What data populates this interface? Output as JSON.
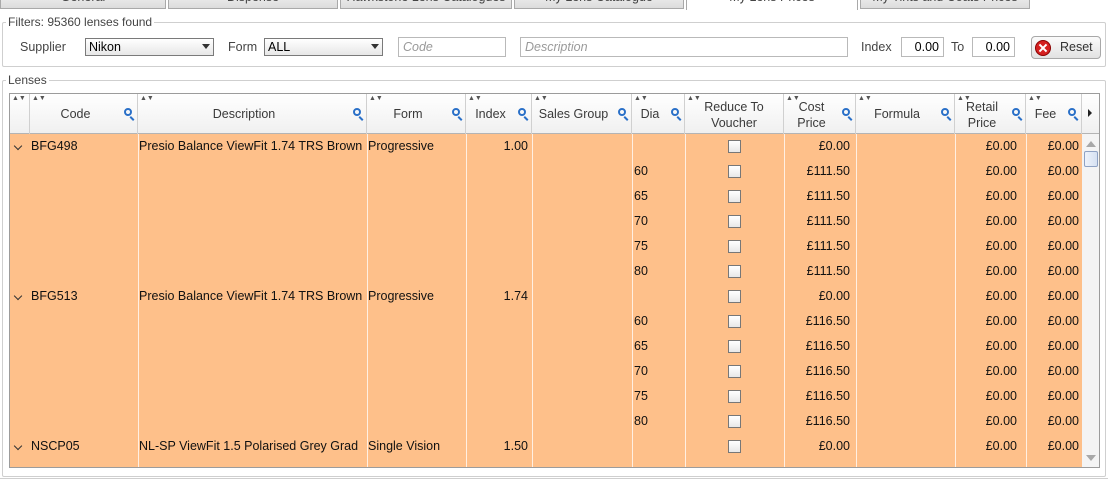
{
  "tabs": [
    {
      "label": "General",
      "active": false
    },
    {
      "label": "Dispense",
      "active": false
    },
    {
      "label": "Hawkstone Lens Catalogues",
      "active": false
    },
    {
      "label": "My Lens Catalogue",
      "active": false
    },
    {
      "label": "My Lens Prices",
      "active": true
    },
    {
      "label": "My Tints and Coats Prices",
      "active": false
    }
  ],
  "filters": {
    "legend": "Filters: 95360 lenses found",
    "supplier_label": "Supplier",
    "supplier_value": "Nikon",
    "form_label": "Form",
    "form_value": "ALL",
    "code_placeholder": "Code",
    "description_placeholder": "Description",
    "index_label": "Index",
    "index_from": "0.00",
    "to_label": "To",
    "index_to": "0.00",
    "reset_label": "Reset"
  },
  "lenses": {
    "legend": "Lenses",
    "columns": [
      {
        "key": "code",
        "label": "Code"
      },
      {
        "key": "description",
        "label": "Description"
      },
      {
        "key": "form",
        "label": "Form"
      },
      {
        "key": "index",
        "label": "Index"
      },
      {
        "key": "sales_group",
        "label": "Sales Group"
      },
      {
        "key": "dia",
        "label": "Dia"
      },
      {
        "key": "reduce",
        "label1": "Reduce To",
        "label2": "Voucher"
      },
      {
        "key": "cost",
        "label1": "Cost",
        "label2": "Price"
      },
      {
        "key": "formula",
        "label": "Formula"
      },
      {
        "key": "retail",
        "label1": "Retail",
        "label2": "Price"
      },
      {
        "key": "fee",
        "label": "Fee"
      }
    ],
    "rows": [
      {
        "parent": true,
        "code": "BFG498",
        "description": "Presio Balance ViewFit  1.74 TRS Brown",
        "form": "Progressive",
        "index": "1.00",
        "dia": "",
        "cost": "£0.00",
        "retail": "£0.00",
        "fee": "£0.00"
      },
      {
        "parent": false,
        "dia": "60",
        "cost": "£111.50",
        "retail": "£0.00",
        "fee": "£0.00"
      },
      {
        "parent": false,
        "dia": "65",
        "cost": "£111.50",
        "retail": "£0.00",
        "fee": "£0.00"
      },
      {
        "parent": false,
        "dia": "70",
        "cost": "£111.50",
        "retail": "£0.00",
        "fee": "£0.00"
      },
      {
        "parent": false,
        "dia": "75",
        "cost": "£111.50",
        "retail": "£0.00",
        "fee": "£0.00"
      },
      {
        "parent": false,
        "dia": "80",
        "cost": "£111.50",
        "retail": "£0.00",
        "fee": "£0.00"
      },
      {
        "parent": true,
        "code": "BFG513",
        "description": "Presio Balance ViewFit  1.74 TRS Brown",
        "form": "Progressive",
        "index": "1.74",
        "dia": "",
        "cost": "£0.00",
        "retail": "£0.00",
        "fee": "£0.00"
      },
      {
        "parent": false,
        "dia": "60",
        "cost": "£116.50",
        "retail": "£0.00",
        "fee": "£0.00"
      },
      {
        "parent": false,
        "dia": "65",
        "cost": "£116.50",
        "retail": "£0.00",
        "fee": "£0.00"
      },
      {
        "parent": false,
        "dia": "70",
        "cost": "£116.50",
        "retail": "£0.00",
        "fee": "£0.00"
      },
      {
        "parent": false,
        "dia": "75",
        "cost": "£116.50",
        "retail": "£0.00",
        "fee": "£0.00"
      },
      {
        "parent": false,
        "dia": "80",
        "cost": "£116.50",
        "retail": "£0.00",
        "fee": "£0.00"
      },
      {
        "parent": true,
        "code": "NSCP05",
        "description": "NL-SP ViewFit 1.5 Polarised Grey Grad",
        "form": "Single Vision",
        "index": "1.50",
        "dia": "",
        "cost": "£0.00",
        "retail": "£0.00",
        "fee": "£0.00"
      }
    ]
  },
  "colors": {
    "row_background": "#fec08a",
    "reset_icon": "#d42020",
    "search_icon": "#2a70c8"
  }
}
